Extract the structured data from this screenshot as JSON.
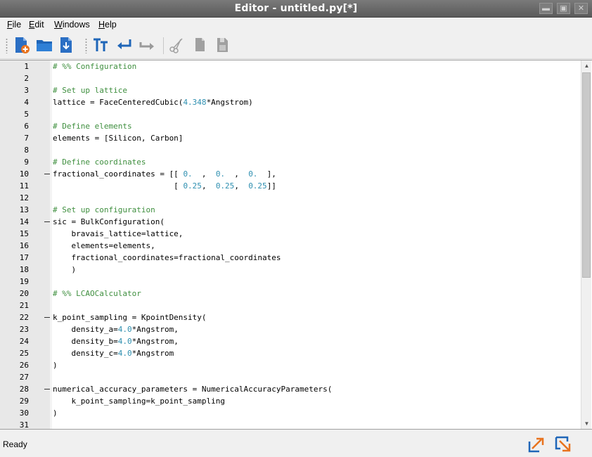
{
  "window": {
    "title": "Editor - untitled.py[*]"
  },
  "menu": [
    {
      "label": "File",
      "mnemonic": "F",
      "rest": "ile"
    },
    {
      "label": "Edit",
      "mnemonic": "E",
      "rest": "dit"
    },
    {
      "label": "Windows",
      "mnemonic": "W",
      "rest": "indows"
    },
    {
      "label": "Help",
      "mnemonic": "H",
      "rest": "elp"
    }
  ],
  "toolbar": {
    "buttons": [
      {
        "icon": "new-file-icon"
      },
      {
        "icon": "open-folder-icon"
      },
      {
        "icon": "save-download-icon"
      },
      {
        "icon": "text-format-icon"
      },
      {
        "icon": "undo-arrow-icon"
      },
      {
        "icon": "redo-arrow-icon"
      },
      {
        "icon": "cut-scissors-icon"
      },
      {
        "icon": "copy-icon"
      },
      {
        "icon": "paste-icon"
      }
    ]
  },
  "colors": {
    "comment": "#3f8f3f",
    "number": "#2e8fb0",
    "titlebar": "#6a6a6a"
  },
  "editor": {
    "lines": [
      {
        "n": "1",
        "fold": false,
        "parts": [
          [
            "cm",
            "# %% Configuration"
          ]
        ]
      },
      {
        "n": "2",
        "fold": false,
        "parts": []
      },
      {
        "n": "3",
        "fold": false,
        "parts": [
          [
            "cm",
            "# Set up lattice"
          ]
        ]
      },
      {
        "n": "4",
        "fold": false,
        "parts": [
          [
            "",
            "lattice = FaceCenteredCubic("
          ],
          [
            "num",
            "4.348"
          ],
          [
            "",
            "*Angstrom)"
          ]
        ]
      },
      {
        "n": "5",
        "fold": false,
        "parts": []
      },
      {
        "n": "6",
        "fold": false,
        "parts": [
          [
            "cm",
            "# Define elements"
          ]
        ]
      },
      {
        "n": "7",
        "fold": false,
        "parts": [
          [
            "",
            "elements = [Silicon, Carbon]"
          ]
        ]
      },
      {
        "n": "8",
        "fold": false,
        "parts": []
      },
      {
        "n": "9",
        "fold": false,
        "parts": [
          [
            "cm",
            "# Define coordinates"
          ]
        ]
      },
      {
        "n": "10",
        "fold": true,
        "parts": [
          [
            "",
            "fractional_coordinates = [[ "
          ],
          [
            "num",
            "0."
          ],
          [
            "",
            "  ,  "
          ],
          [
            "num",
            "0."
          ],
          [
            "",
            "  ,  "
          ],
          [
            "num",
            "0."
          ],
          [
            "",
            "  ],"
          ]
        ]
      },
      {
        "n": "11",
        "fold": false,
        "parts": [
          [
            "",
            "                          [ "
          ],
          [
            "num",
            "0.25"
          ],
          [
            "",
            ",  "
          ],
          [
            "num",
            "0.25"
          ],
          [
            "",
            ",  "
          ],
          [
            "num",
            "0.25"
          ],
          [
            "",
            "]]"
          ]
        ]
      },
      {
        "n": "12",
        "fold": false,
        "parts": []
      },
      {
        "n": "13",
        "fold": false,
        "parts": [
          [
            "cm",
            "# Set up configuration"
          ]
        ]
      },
      {
        "n": "14",
        "fold": true,
        "parts": [
          [
            "",
            "sic = BulkConfiguration("
          ]
        ]
      },
      {
        "n": "15",
        "fold": false,
        "parts": [
          [
            "",
            "    bravais_lattice=lattice,"
          ]
        ]
      },
      {
        "n": "16",
        "fold": false,
        "parts": [
          [
            "",
            "    elements=elements,"
          ]
        ]
      },
      {
        "n": "17",
        "fold": false,
        "parts": [
          [
            "",
            "    fractional_coordinates=fractional_coordinates"
          ]
        ]
      },
      {
        "n": "18",
        "fold": false,
        "parts": [
          [
            "",
            "    )"
          ]
        ]
      },
      {
        "n": "19",
        "fold": false,
        "parts": []
      },
      {
        "n": "20",
        "fold": false,
        "parts": [
          [
            "cm",
            "# %% LCAOCalculator"
          ]
        ]
      },
      {
        "n": "21",
        "fold": false,
        "parts": []
      },
      {
        "n": "22",
        "fold": true,
        "parts": [
          [
            "",
            "k_point_sampling = KpointDensity("
          ]
        ]
      },
      {
        "n": "23",
        "fold": false,
        "parts": [
          [
            "",
            "    density_a="
          ],
          [
            "num",
            "4.0"
          ],
          [
            "",
            "*Angstrom,"
          ]
        ]
      },
      {
        "n": "24",
        "fold": false,
        "parts": [
          [
            "",
            "    density_b="
          ],
          [
            "num",
            "4.0"
          ],
          [
            "",
            "*Angstrom,"
          ]
        ]
      },
      {
        "n": "25",
        "fold": false,
        "parts": [
          [
            "",
            "    density_c="
          ],
          [
            "num",
            "4.0"
          ],
          [
            "",
            "*Angstrom"
          ]
        ]
      },
      {
        "n": "26",
        "fold": false,
        "parts": [
          [
            "",
            ")"
          ]
        ]
      },
      {
        "n": "27",
        "fold": false,
        "parts": []
      },
      {
        "n": "28",
        "fold": true,
        "parts": [
          [
            "",
            "numerical_accuracy_parameters = NumericalAccuracyParameters("
          ]
        ]
      },
      {
        "n": "29",
        "fold": false,
        "parts": [
          [
            "",
            "    k_point_sampling=k_point_sampling"
          ]
        ]
      },
      {
        "n": "30",
        "fold": false,
        "parts": [
          [
            "",
            ")"
          ]
        ]
      },
      {
        "n": "31",
        "fold": false,
        "parts": []
      }
    ]
  },
  "status": {
    "text": "Ready"
  }
}
